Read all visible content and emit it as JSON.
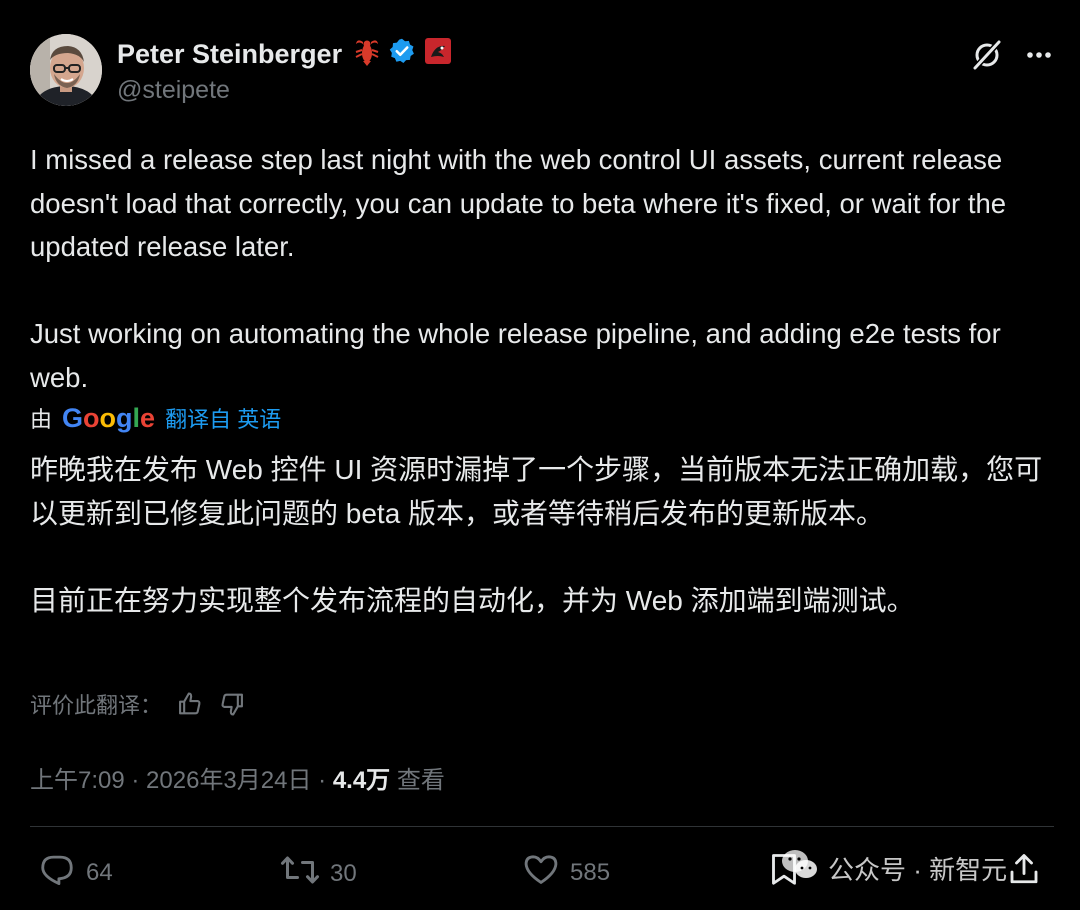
{
  "author": {
    "name": "Peter Steinberger",
    "handle": "@steipete"
  },
  "tweet": {
    "paragraphs": [
      "I missed a release step last night with the web control UI assets, current release doesn't load that correctly, you can update to beta where it's fixed, or wait for the updated release later.",
      "Just working on automating the whole release pipeline, and adding e2e tests for web."
    ]
  },
  "translation": {
    "prefix": "由",
    "provider": "Google",
    "link_text": "翻译自 英语",
    "paragraphs": [
      "昨晚我在发布 Web 控件 UI 资源时漏掉了一个步骤，当前版本无法正确加载，您可以更新到已修复此问题的 beta 版本，或者等待稍后发布的更新版本。",
      "目前正在努力实现整个发布流程的自动化，并为 Web 添加端到端测试。"
    ],
    "rate_label": "评价此翻译："
  },
  "meta": {
    "time": "上午7:09",
    "separator": " · ",
    "date": "2026年3月24日",
    "views": "4.4万",
    "views_label": "查看"
  },
  "actions": {
    "replies": "64",
    "reposts": "30",
    "likes": "585"
  },
  "watermark": {
    "text": "公众号 · 新智元"
  },
  "colors": {
    "background": "#000000",
    "text": "#e7e9ea",
    "muted": "#71767b",
    "link": "#1d9bf0",
    "verified": "#1d9bf0"
  },
  "icons": {
    "header": [
      "grok-icon",
      "more-icon"
    ],
    "actions": [
      "reply-icon",
      "repost-icon",
      "like-icon",
      "bookmark-icon",
      "share-icon"
    ]
  }
}
